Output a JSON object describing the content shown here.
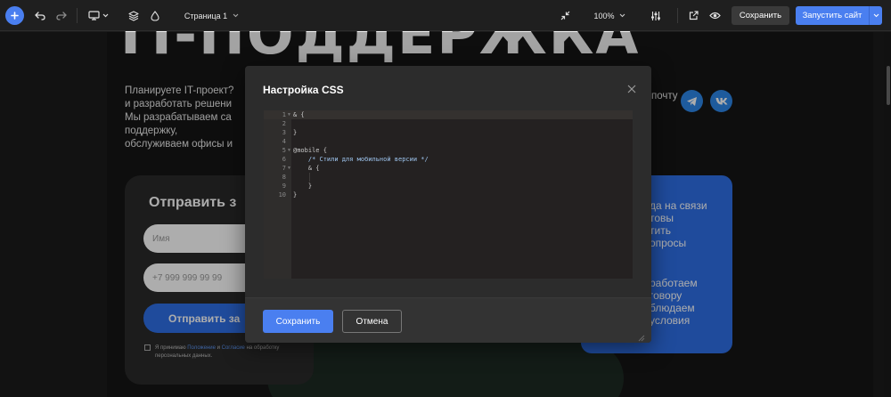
{
  "toolbar": {
    "page_label": "Страница 1",
    "zoom": "100%",
    "save_label": "Сохранить",
    "launch_label": "Запустить сайт"
  },
  "canvas": {
    "hero_title": "IT-ПОДДЕРЖКА",
    "hero_lines": [
      "Планируете IT-проект?",
      "и разработать решени",
      "Мы разрабатываем са",
      "поддержку,",
      "обслуживаем офисы и"
    ],
    "pochtu": "почту",
    "form": {
      "title": "Отправить з",
      "name_placeholder": "Имя",
      "phone_placeholder": "+7 999 999 99 99",
      "submit_label": "Отправить за",
      "consent_prefix": "Я принимаю ",
      "consent_link1": "Положение",
      "consent_and": " и ",
      "consent_link2": "Согласие",
      "consent_suffix": " на обработку персональных данных."
    },
    "blue_card_lines_top": [
      "да на связи",
      "товы",
      "тить",
      "опросы"
    ],
    "blue_card_lines_bottom": [
      "работаем",
      "говору",
      "блюдаем",
      "условия"
    ]
  },
  "modal": {
    "title": "Настройка CSS",
    "line_numbers": [
      "1",
      "2",
      "3",
      "4",
      "5",
      "6",
      "7",
      "8",
      "9",
      "10"
    ],
    "code_lines": [
      "& {",
      "",
      "}",
      "",
      "@mobile {",
      "    /* Стили для мобильной версии */",
      "    & {",
      "",
      "    }",
      "}"
    ],
    "save_label": "Сохранить",
    "cancel_label": "Отмена"
  },
  "colors": {
    "accent": "#4a7ff0",
    "background": "#1b1b1b",
    "modal": "#2c2c2c",
    "editor": "#242121",
    "comment": "#9fc6f0"
  },
  "icons": [
    "plus-icon",
    "undo-icon",
    "redo-icon",
    "desktop-icon",
    "chevron-down-icon",
    "layers-icon",
    "drop-icon",
    "collapse-icon",
    "sliders-icon",
    "external-link-icon",
    "eye-icon",
    "close-icon",
    "telegram-icon",
    "vk-icon",
    "resize-handle-icon"
  ]
}
